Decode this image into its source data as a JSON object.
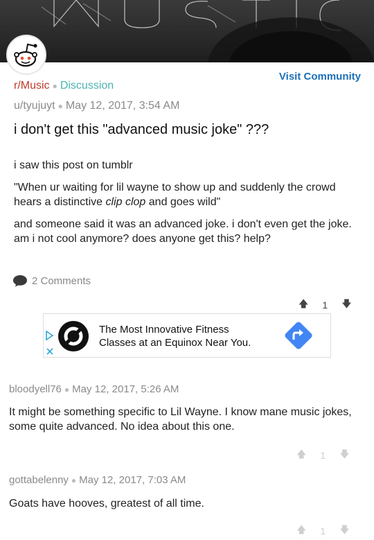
{
  "subreddit": "r/Music",
  "flair": "Discussion",
  "visit_label": "Visit Community",
  "post": {
    "author": "u/tyujuyt",
    "timestamp": "May 12, 2017, 3:54 AM",
    "title": "i don't get this \"advanced music joke\" ???",
    "para1": "i saw this post on tumblr",
    "quote_before": "\"When ur waiting for lil wayne to show up and suddenly the crowd hears a distinctive ",
    "quote_italic": "clip clop",
    "quote_after": " and goes wild\"",
    "para3": "and someone said it was an advanced joke. i don't even get the joke. am i not cool anymore? does anyone get this? help?",
    "comments_count": "2 Comments",
    "score": "1"
  },
  "ad": {
    "text": "The Most Innovative Fitness Classes at an Equinox Near You."
  },
  "comments": [
    {
      "author": "bloodyell76",
      "timestamp": "May 12, 2017, 5:26 AM",
      "text": "It might be something specific to Lil Wayne. I know mane music jokes, some quite advanced. No idea about this one.",
      "score": "1"
    },
    {
      "author": "gottabelenny",
      "timestamp": "May 12, 2017, 7:03 AM",
      "text": "Goats have hooves, greatest of all time.",
      "score": "1"
    }
  ],
  "colors": {
    "subreddit": "#c0392b",
    "flair": "#4bb3b0",
    "link": "#1d6fb8",
    "ad_accent": "#4285f4"
  }
}
